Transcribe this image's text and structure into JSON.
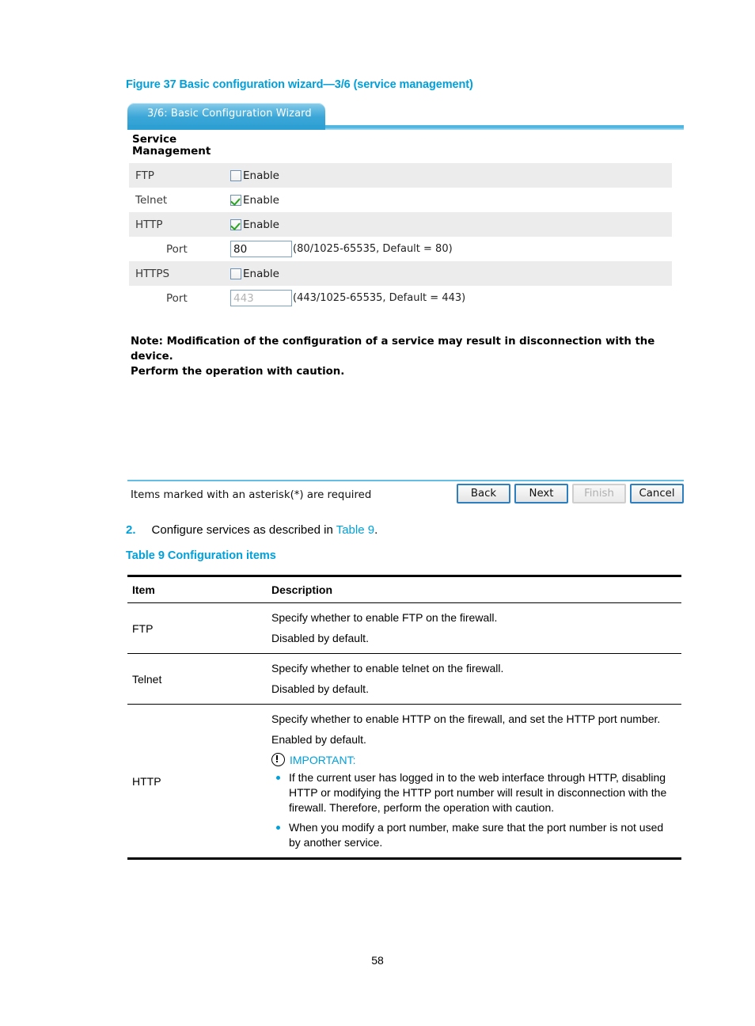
{
  "figure": {
    "caption": "Figure 37 Basic configuration wizard—3/6 (service management)"
  },
  "wizard": {
    "tab_label": "3/6: Basic Configuration Wizard",
    "section_title": "Service Management",
    "rows": [
      {
        "label": "FTP",
        "control": "checkbox",
        "checkbox_label": "Enable",
        "checked": false
      },
      {
        "label": "Telnet",
        "control": "checkbox",
        "checkbox_label": "Enable",
        "checked": true
      },
      {
        "label": "HTTP",
        "control": "checkbox",
        "checkbox_label": "Enable",
        "checked": true
      },
      {
        "label": "Port",
        "control": "input",
        "value": "80",
        "hint": "(80/1025-65535, Default = 80)",
        "disabled": false
      },
      {
        "label": "HTTPS",
        "control": "checkbox",
        "checkbox_label": "Enable",
        "checked": false
      },
      {
        "label": "Port",
        "control": "input",
        "value": "443",
        "hint": "(443/1025-65535, Default = 443)",
        "disabled": true
      }
    ],
    "note_line1": "Note: Modification of the configuration of a service may result in disconnection with the device.",
    "note_line2": "Perform the operation with caution.",
    "required_text": "Items marked with an asterisk(*) are required",
    "buttons": [
      {
        "label": "Back",
        "disabled": false
      },
      {
        "label": "Next",
        "disabled": false
      },
      {
        "label": "Finish",
        "disabled": true
      },
      {
        "label": "Cancel",
        "disabled": false
      }
    ]
  },
  "step": {
    "number": "2.",
    "text_before": "Configure services as described in ",
    "link": "Table 9",
    "text_after": "."
  },
  "table9": {
    "caption": "Table 9 Configuration items",
    "headers": [
      "Item",
      "Description"
    ],
    "rows": [
      {
        "item": "FTP",
        "lines": [
          "Specify whether to enable FTP on the firewall.",
          "Disabled by default."
        ]
      },
      {
        "item": "Telnet",
        "lines": [
          "Specify whether to enable telnet on the firewall.",
          "Disabled by default."
        ]
      },
      {
        "item": "HTTP",
        "lines": [
          "Specify whether to enable HTTP on the firewall, and set the HTTP port number.",
          "Enabled by default."
        ],
        "important_label": "IMPORTANT:",
        "bullets": [
          "If the current user has logged in to the web interface through HTTP, disabling HTTP or modifying the HTTP port number will result in disconnection with the firewall. Therefore, perform the operation with caution.",
          "When you modify a port number, make sure that the port number is not used by another service."
        ]
      }
    ]
  },
  "footer": {
    "page_number": "58"
  },
  "colors": {
    "accent_blue": "#00a0db",
    "tab_blue": "#2e9fd3",
    "row_shade": "#ececec",
    "check_green": "#2aa321"
  }
}
